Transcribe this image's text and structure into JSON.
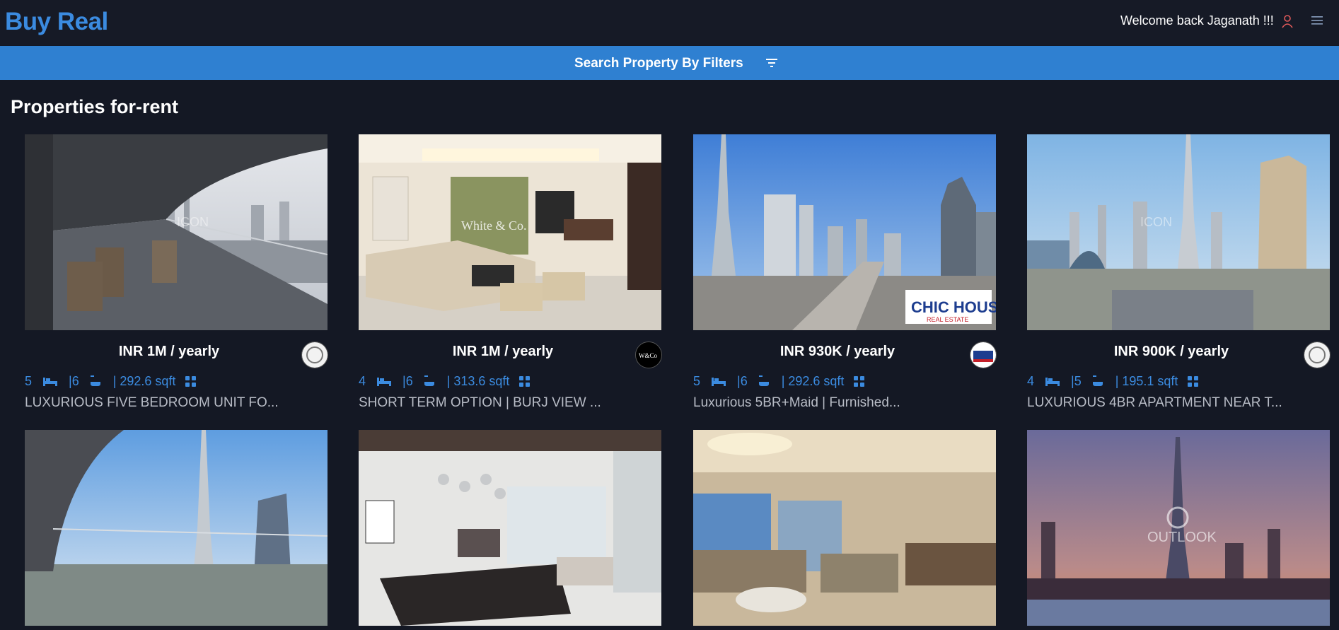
{
  "header": {
    "brand": "Buy Real",
    "welcome": "Welcome back Jaganath !!!",
    "user_icon": "user-icon",
    "menu_icon": "hamburger-menu-icon"
  },
  "filters": {
    "label": "Search Property By Filters",
    "icon": "filter-icon"
  },
  "section": {
    "title": "Properties for-rent"
  },
  "listings": [
    {
      "price": "INR 1M / yearly",
      "rooms": "5",
      "baths": "|6",
      "area": "| 292.6 sqft",
      "title": "LUXURIOUS FIVE BEDROOM UNIT FO..."
    },
    {
      "price": "INR 1M / yearly",
      "rooms": "4",
      "baths": "|6",
      "area": "| 313.6 sqft",
      "title": "SHORT TERM OPTION | BURJ VIEW ..."
    },
    {
      "price": "INR 930K / yearly",
      "rooms": "5",
      "baths": "|6",
      "area": "| 292.6 sqft",
      "title": "Luxurious 5BR+Maid | Furnished..."
    },
    {
      "price": "INR 900K / yearly",
      "rooms": "4",
      "baths": "|5",
      "area": "| 195.1 sqft",
      "title": "LUXURIOUS 4BR APARTMENT NEAR T..."
    }
  ],
  "watermarks": {
    "w1": "ICON",
    "w2": "White & Co.",
    "w3": "CHIC HOUSE",
    "w3b": "REAL ESTATE",
    "w4": "OUTLOOK"
  },
  "colors": {
    "accent": "#2f80d1",
    "brand": "#3b8be0",
    "background": "#141824"
  }
}
